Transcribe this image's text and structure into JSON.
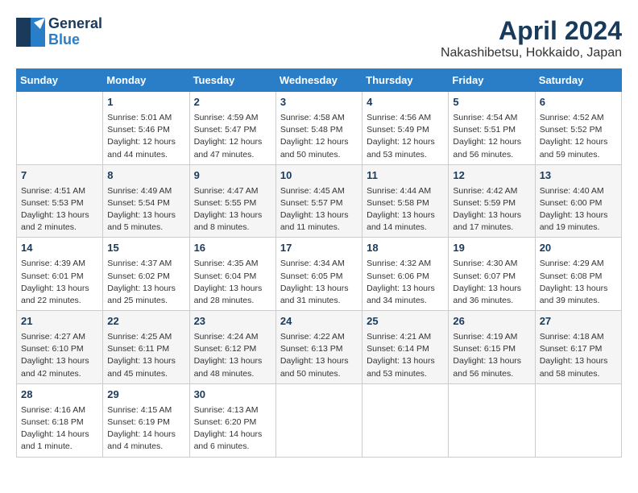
{
  "logo": {
    "line1": "General",
    "line2": "Blue"
  },
  "title": "April 2024",
  "subtitle": "Nakashibetsu, Hokkaido, Japan",
  "days_of_week": [
    "Sunday",
    "Monday",
    "Tuesday",
    "Wednesday",
    "Thursday",
    "Friday",
    "Saturday"
  ],
  "weeks": [
    [
      {
        "day": "",
        "info": ""
      },
      {
        "day": "1",
        "info": "Sunrise: 5:01 AM\nSunset: 5:46 PM\nDaylight: 12 hours\nand 44 minutes."
      },
      {
        "day": "2",
        "info": "Sunrise: 4:59 AM\nSunset: 5:47 PM\nDaylight: 12 hours\nand 47 minutes."
      },
      {
        "day": "3",
        "info": "Sunrise: 4:58 AM\nSunset: 5:48 PM\nDaylight: 12 hours\nand 50 minutes."
      },
      {
        "day": "4",
        "info": "Sunrise: 4:56 AM\nSunset: 5:49 PM\nDaylight: 12 hours\nand 53 minutes."
      },
      {
        "day": "5",
        "info": "Sunrise: 4:54 AM\nSunset: 5:51 PM\nDaylight: 12 hours\nand 56 minutes."
      },
      {
        "day": "6",
        "info": "Sunrise: 4:52 AM\nSunset: 5:52 PM\nDaylight: 12 hours\nand 59 minutes."
      }
    ],
    [
      {
        "day": "7",
        "info": "Sunrise: 4:51 AM\nSunset: 5:53 PM\nDaylight: 13 hours\nand 2 minutes."
      },
      {
        "day": "8",
        "info": "Sunrise: 4:49 AM\nSunset: 5:54 PM\nDaylight: 13 hours\nand 5 minutes."
      },
      {
        "day": "9",
        "info": "Sunrise: 4:47 AM\nSunset: 5:55 PM\nDaylight: 13 hours\nand 8 minutes."
      },
      {
        "day": "10",
        "info": "Sunrise: 4:45 AM\nSunset: 5:57 PM\nDaylight: 13 hours\nand 11 minutes."
      },
      {
        "day": "11",
        "info": "Sunrise: 4:44 AM\nSunset: 5:58 PM\nDaylight: 13 hours\nand 14 minutes."
      },
      {
        "day": "12",
        "info": "Sunrise: 4:42 AM\nSunset: 5:59 PM\nDaylight: 13 hours\nand 17 minutes."
      },
      {
        "day": "13",
        "info": "Sunrise: 4:40 AM\nSunset: 6:00 PM\nDaylight: 13 hours\nand 19 minutes."
      }
    ],
    [
      {
        "day": "14",
        "info": "Sunrise: 4:39 AM\nSunset: 6:01 PM\nDaylight: 13 hours\nand 22 minutes."
      },
      {
        "day": "15",
        "info": "Sunrise: 4:37 AM\nSunset: 6:02 PM\nDaylight: 13 hours\nand 25 minutes."
      },
      {
        "day": "16",
        "info": "Sunrise: 4:35 AM\nSunset: 6:04 PM\nDaylight: 13 hours\nand 28 minutes."
      },
      {
        "day": "17",
        "info": "Sunrise: 4:34 AM\nSunset: 6:05 PM\nDaylight: 13 hours\nand 31 minutes."
      },
      {
        "day": "18",
        "info": "Sunrise: 4:32 AM\nSunset: 6:06 PM\nDaylight: 13 hours\nand 34 minutes."
      },
      {
        "day": "19",
        "info": "Sunrise: 4:30 AM\nSunset: 6:07 PM\nDaylight: 13 hours\nand 36 minutes."
      },
      {
        "day": "20",
        "info": "Sunrise: 4:29 AM\nSunset: 6:08 PM\nDaylight: 13 hours\nand 39 minutes."
      }
    ],
    [
      {
        "day": "21",
        "info": "Sunrise: 4:27 AM\nSunset: 6:10 PM\nDaylight: 13 hours\nand 42 minutes."
      },
      {
        "day": "22",
        "info": "Sunrise: 4:25 AM\nSunset: 6:11 PM\nDaylight: 13 hours\nand 45 minutes."
      },
      {
        "day": "23",
        "info": "Sunrise: 4:24 AM\nSunset: 6:12 PM\nDaylight: 13 hours\nand 48 minutes."
      },
      {
        "day": "24",
        "info": "Sunrise: 4:22 AM\nSunset: 6:13 PM\nDaylight: 13 hours\nand 50 minutes."
      },
      {
        "day": "25",
        "info": "Sunrise: 4:21 AM\nSunset: 6:14 PM\nDaylight: 13 hours\nand 53 minutes."
      },
      {
        "day": "26",
        "info": "Sunrise: 4:19 AM\nSunset: 6:15 PM\nDaylight: 13 hours\nand 56 minutes."
      },
      {
        "day": "27",
        "info": "Sunrise: 4:18 AM\nSunset: 6:17 PM\nDaylight: 13 hours\nand 58 minutes."
      }
    ],
    [
      {
        "day": "28",
        "info": "Sunrise: 4:16 AM\nSunset: 6:18 PM\nDaylight: 14 hours\nand 1 minute."
      },
      {
        "day": "29",
        "info": "Sunrise: 4:15 AM\nSunset: 6:19 PM\nDaylight: 14 hours\nand 4 minutes."
      },
      {
        "day": "30",
        "info": "Sunrise: 4:13 AM\nSunset: 6:20 PM\nDaylight: 14 hours\nand 6 minutes."
      },
      {
        "day": "",
        "info": ""
      },
      {
        "day": "",
        "info": ""
      },
      {
        "day": "",
        "info": ""
      },
      {
        "day": "",
        "info": ""
      }
    ]
  ]
}
